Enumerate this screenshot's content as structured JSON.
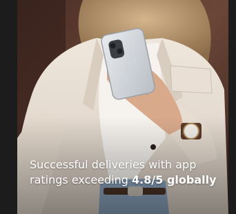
{
  "card": {
    "caption_part1": "Successful deliveries with app ratings exceeding ",
    "caption_highlight": "4.8/5 globally",
    "photo_subject": "woman-holding-smartphone"
  },
  "colors": {
    "background": "#1c1c1c",
    "jacket": "#e6dcd1",
    "caption_text": "#ffffff"
  }
}
